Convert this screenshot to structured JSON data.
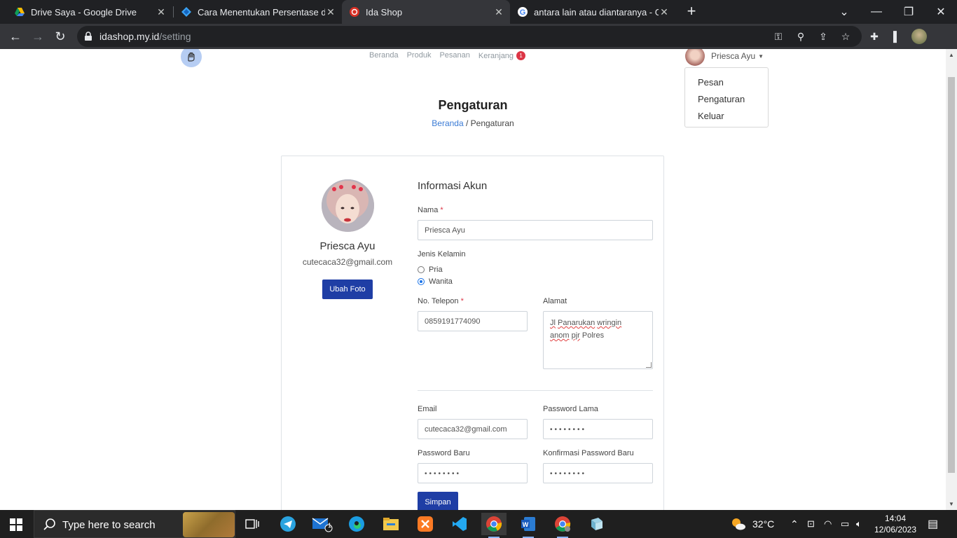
{
  "browser": {
    "tabs": [
      {
        "title": "Drive Saya - Google Drive",
        "icon": "google-drive-icon"
      },
      {
        "title": "Cara Menentukan Persentase dari",
        "icon": "blog-icon"
      },
      {
        "title": "Ida Shop",
        "icon": "ida-shop-icon",
        "active": true
      },
      {
        "title": "antara lain atau diantaranya - Go",
        "icon": "google-icon"
      }
    ],
    "url_host": "idashop.my.id",
    "url_path": "/setting"
  },
  "nav": {
    "links": [
      "Beranda",
      "Produk",
      "Pesanan",
      "Keranjang"
    ],
    "cart_count": "1",
    "user_name": "Priesca Ayu",
    "dropdown": [
      "Pesan",
      "Pengaturan",
      "Keluar"
    ]
  },
  "page": {
    "title": "Pengaturan",
    "breadcrumb_home": "Beranda",
    "breadcrumb_sep": " / ",
    "breadcrumb_current": "Pengaturan"
  },
  "profile": {
    "name": "Priesca Ayu",
    "email": "cutecaca32@gmail.com",
    "change_photo_label": "Ubah Foto"
  },
  "form": {
    "section_title": "Informasi Akun",
    "name_label": "Nama",
    "required_mark": "*",
    "name_value": "Priesca Ayu",
    "gender_label": "Jenis Kelamin",
    "gender_options": [
      "Pria",
      "Wanita"
    ],
    "gender_selected": "Wanita",
    "phone_label": "No. Telepon",
    "phone_value": "0859191774090",
    "address_label": "Alamat",
    "address_line1_a": "Jl",
    "address_line1_b": "Panarukan",
    "address_line1_c": "wringin",
    "address_line2_a": "anom",
    "address_line2_b": "pjr",
    "address_line2_c": "Polres",
    "email_label": "Email",
    "email_value": "cutecaca32@gmail.com",
    "old_password_label": "Password Lama",
    "old_password_value": "••••••••",
    "new_password_label": "Password Baru",
    "new_password_value": "••••••••",
    "confirm_password_label": "Konfirmasi Password Baru",
    "confirm_password_value": "••••••••",
    "save_label": "Simpan"
  },
  "taskbar": {
    "search_placeholder": "Type here to search",
    "mail_badge": "1",
    "temperature": "32°C",
    "time": "14:04",
    "date": "12/06/2023"
  },
  "colors": {
    "primary_button": "#1f3ea5",
    "link": "#3a7bd5",
    "badge": "#dc3545"
  }
}
